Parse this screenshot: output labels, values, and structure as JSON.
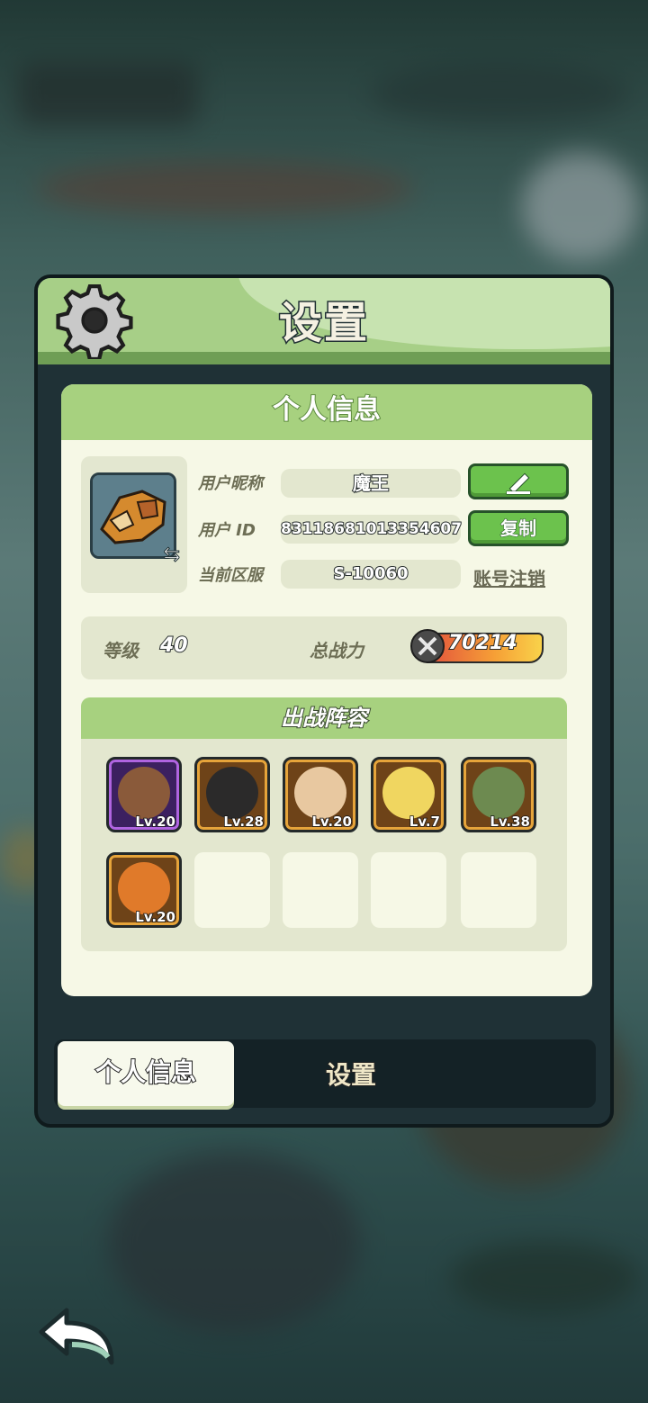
{
  "title": "设置",
  "card_title": "个人信息",
  "profile": {
    "nickname_label": "用户昵称",
    "nickname": "魔王",
    "uid_label": "用户 ID",
    "uid": "83118681013354607",
    "copy_label": "复制",
    "server_label": "当前区服",
    "server": "S-10060",
    "delete_account_label": "账号注销"
  },
  "stats": {
    "level_label": "等级",
    "level": "40",
    "power_label": "总战力",
    "power": "70214"
  },
  "lineup": {
    "title": "出战阵容",
    "heroes": [
      {
        "level": "Lv.20",
        "frame": "purple"
      },
      {
        "level": "Lv.28",
        "frame": "gold"
      },
      {
        "level": "Lv.20",
        "frame": "gold"
      },
      {
        "level": "Lv.7",
        "frame": "gold"
      },
      {
        "level": "Lv.38",
        "frame": "gold"
      },
      {
        "level": "Lv.20",
        "frame": "gold"
      }
    ],
    "empty_slots": 4
  },
  "tabs": {
    "active": "个人信息",
    "settings": "设置"
  },
  "icons": [
    "gear-icon",
    "edit-pencil-icon",
    "swap-icon",
    "battle-power-icon",
    "back-arrow-icon"
  ]
}
